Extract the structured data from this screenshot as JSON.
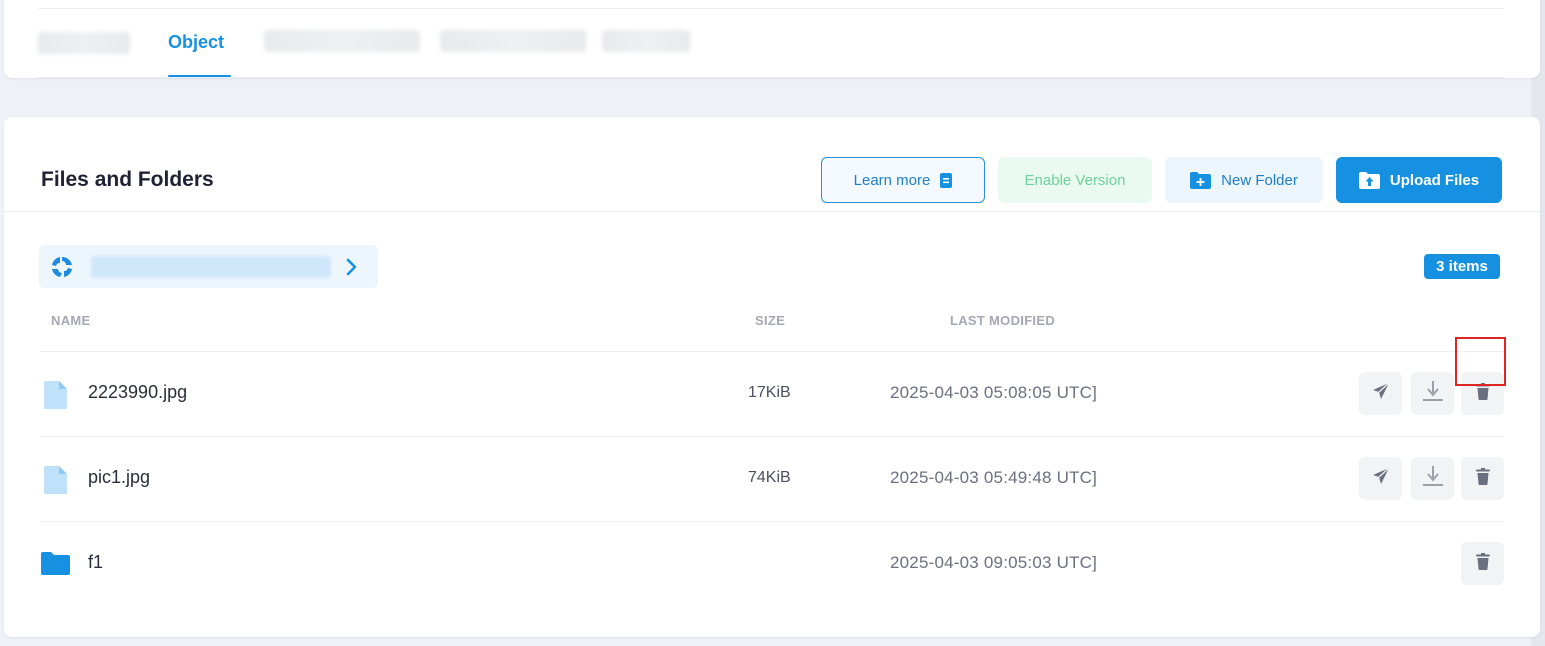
{
  "tabs": {
    "active_label": "Object"
  },
  "header": {
    "title": "Files and Folders",
    "learn_more": "Learn more",
    "enable_version": "Enable Version",
    "new_folder": "New Folder",
    "upload_files": "Upload Files"
  },
  "count_badge": "3 items",
  "columns": {
    "name": "NAME",
    "size": "SIZE",
    "last_modified": "LAST MODIFIED"
  },
  "rows": [
    {
      "name": "2223990.jpg",
      "size": "17KiB",
      "modified": "2025-04-03 05:08:05 UTC]",
      "type": "file"
    },
    {
      "name": "pic1.jpg",
      "size": "74KiB",
      "modified": "2025-04-03 05:49:48 UTC]",
      "type": "file"
    },
    {
      "name": "f1",
      "size": "",
      "modified": "2025-04-03 09:05:03 UTC]",
      "type": "folder"
    }
  ],
  "colors": {
    "accent": "#1691e2",
    "green_text": "#6dd19a",
    "highlight": "#e02424"
  },
  "icons": [
    "document-icon",
    "folder-plus-icon",
    "upload-icon",
    "share-icon",
    "download-icon",
    "trash-icon",
    "chevron-right-icon",
    "file-icon",
    "folder-icon",
    "bucket-logo-icon"
  ]
}
